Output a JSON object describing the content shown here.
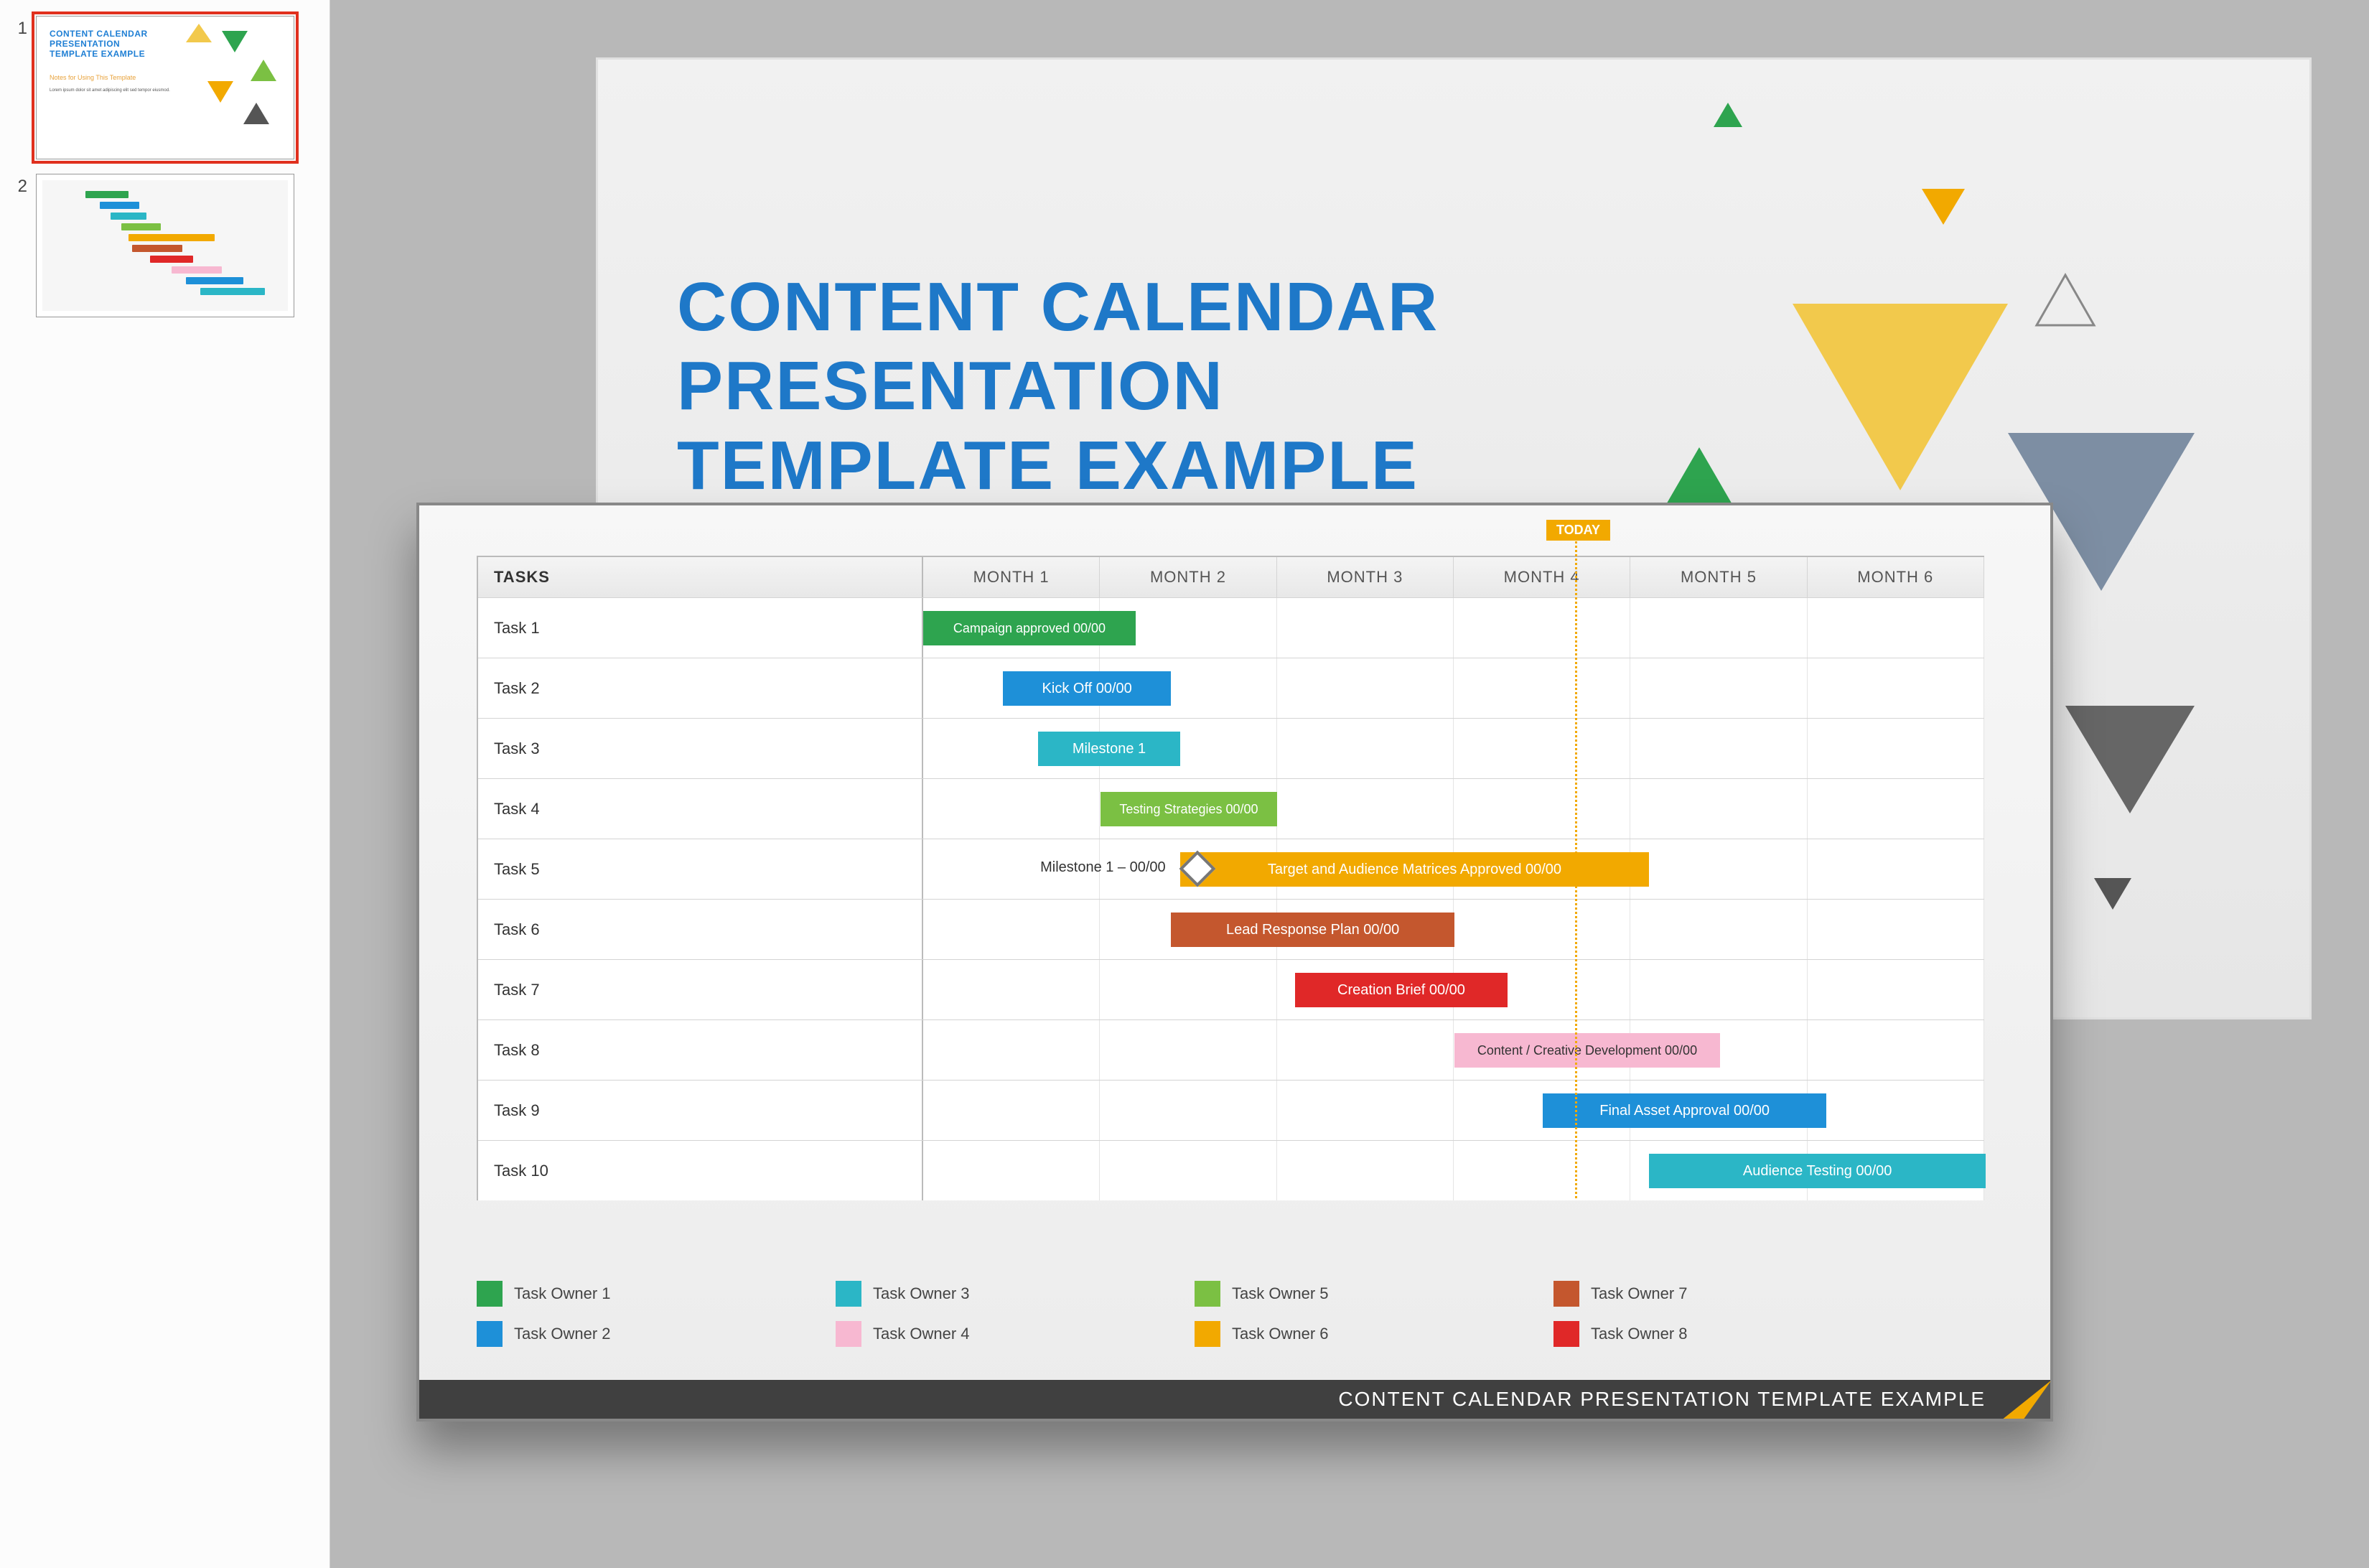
{
  "thumbnails": {
    "nums": [
      "1",
      "2"
    ],
    "slide1_title": "CONTENT CALENDAR\nPRESENTATION\nTEMPLATE EXAMPLE",
    "slide1_notes": "Notes for Using This Template"
  },
  "slide1": {
    "title_line1": "CONTENT CALENDAR",
    "title_line2": "PRESENTATION",
    "title_line3": "TEMPLATE EXAMPLE"
  },
  "gantt": {
    "today_label": "TODAY",
    "tasks_header": "TASKS",
    "months": [
      "MONTH 1",
      "MONTH 2",
      "MONTH 3",
      "MONTH 4",
      "MONTH 5",
      "MONTH 6"
    ],
    "rows": [
      {
        "task": "Task 1",
        "bar": {
          "text": "Campaign approved 00/00",
          "color": "#2ea44f",
          "start": 0.0,
          "end": 1.2,
          "twoLine": true
        }
      },
      {
        "task": "Task 2",
        "bar": {
          "text": "Kick Off 00/00",
          "color": "#1e90d8",
          "start": 0.45,
          "end": 1.4
        }
      },
      {
        "task": "Task 3",
        "bar": {
          "text": "Milestone 1",
          "color": "#2bb6c6",
          "start": 0.65,
          "end": 1.45
        }
      },
      {
        "task": "Task 4",
        "bar": {
          "text": "Testing Strategies 00/00",
          "color": "#7bc043",
          "start": 1.0,
          "end": 2.0,
          "twoLine": true
        }
      },
      {
        "task": "Task 5",
        "bar": {
          "text": "Target and Audience Matrices Approved 00/00",
          "color": "#f2a900",
          "start": 1.45,
          "end": 4.1
        },
        "pre_label": "Milestone 1 – 00/00",
        "diamond_at": 1.55
      },
      {
        "task": "Task 6",
        "bar": {
          "text": "Lead Response Plan 00/00",
          "color": "#c4572e",
          "start": 1.4,
          "end": 3.0
        }
      },
      {
        "task": "Task 7",
        "bar": {
          "text": "Creation Brief 00/00",
          "color": "#e02828",
          "start": 2.1,
          "end": 3.3
        }
      },
      {
        "task": "Task 8",
        "bar": {
          "text": "Content / Creative Development 00/00",
          "color": "#f7b8d1",
          "start": 3.0,
          "end": 4.5,
          "darkText": true,
          "twoLine": true
        }
      },
      {
        "task": "Task 9",
        "bar": {
          "text": "Final Asset Approval 00/00",
          "color": "#1e90d8",
          "start": 3.5,
          "end": 5.1
        }
      },
      {
        "task": "Task 10",
        "bar": {
          "text": "Audience Testing 00/00",
          "color": "#2bb6c6",
          "start": 4.1,
          "end": 6.0
        }
      }
    ],
    "legend": [
      {
        "label": "Task Owner 1",
        "color": "#2ea44f"
      },
      {
        "label": "Task Owner 2",
        "color": "#1e90d8"
      },
      {
        "label": "Task Owner 3",
        "color": "#2bb6c6"
      },
      {
        "label": "Task Owner 4",
        "color": "#f7b8d1"
      },
      {
        "label": "Task Owner 5",
        "color": "#7bc043"
      },
      {
        "label": "Task Owner 6",
        "color": "#f2a900"
      },
      {
        "label": "Task Owner 7",
        "color": "#c4572e"
      },
      {
        "label": "Task Owner 8",
        "color": "#e02828"
      }
    ],
    "footer": "CONTENT CALENDAR PRESENTATION TEMPLATE EXAMPLE"
  },
  "chart_data": {
    "type": "gantt",
    "time_axis": {
      "unit": "month",
      "categories": [
        "MONTH 1",
        "MONTH 2",
        "MONTH 3",
        "MONTH 4",
        "MONTH 5",
        "MONTH 6"
      ],
      "today_position": 4.0
    },
    "tasks": [
      {
        "name": "Task 1",
        "label": "Campaign approved 00/00",
        "owner": "Task Owner 1",
        "start_month": 1.0,
        "end_month": 2.2
      },
      {
        "name": "Task 2",
        "label": "Kick Off 00/00",
        "owner": "Task Owner 2",
        "start_month": 1.45,
        "end_month": 2.4
      },
      {
        "name": "Task 3",
        "label": "Milestone 1",
        "owner": "Task Owner 3",
        "start_month": 1.65,
        "end_month": 2.45
      },
      {
        "name": "Task 4",
        "label": "Testing Strategies 00/00",
        "owner": "Task Owner 5",
        "start_month": 2.0,
        "end_month": 3.0
      },
      {
        "name": "Task 5",
        "label": "Target and Audience Matrices Approved 00/00",
        "owner": "Task Owner 6",
        "start_month": 2.45,
        "end_month": 5.1,
        "milestone": {
          "label": "Milestone 1 – 00/00",
          "at_month": 2.55
        }
      },
      {
        "name": "Task 6",
        "label": "Lead Response Plan 00/00",
        "owner": "Task Owner 7",
        "start_month": 2.4,
        "end_month": 4.0
      },
      {
        "name": "Task 7",
        "label": "Creation Brief 00/00",
        "owner": "Task Owner 8",
        "start_month": 3.1,
        "end_month": 4.3
      },
      {
        "name": "Task 8",
        "label": "Content / Creative Development 00/00",
        "owner": "Task Owner 4",
        "start_month": 4.0,
        "end_month": 5.5
      },
      {
        "name": "Task 9",
        "label": "Final Asset Approval 00/00",
        "owner": "Task Owner 2",
        "start_month": 4.5,
        "end_month": 6.1
      },
      {
        "name": "Task 10",
        "label": "Audience Testing 00/00",
        "owner": "Task Owner 3",
        "start_month": 5.1,
        "end_month": 7.0
      }
    ],
    "owners": [
      {
        "name": "Task Owner 1",
        "color": "#2ea44f"
      },
      {
        "name": "Task Owner 2",
        "color": "#1e90d8"
      },
      {
        "name": "Task Owner 3",
        "color": "#2bb6c6"
      },
      {
        "name": "Task Owner 4",
        "color": "#f7b8d1"
      },
      {
        "name": "Task Owner 5",
        "color": "#7bc043"
      },
      {
        "name": "Task Owner 6",
        "color": "#f2a900"
      },
      {
        "name": "Task Owner 7",
        "color": "#c4572e"
      },
      {
        "name": "Task Owner 8",
        "color": "#e02828"
      }
    ]
  }
}
